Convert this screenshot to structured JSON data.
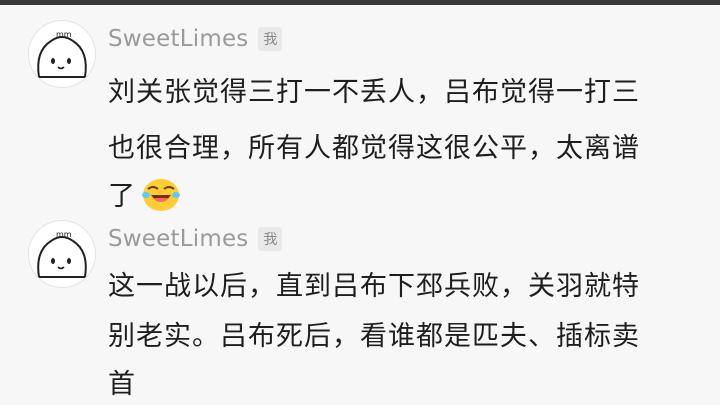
{
  "comments": [
    {
      "username": "SweetLimes",
      "badge": "我",
      "avatar_icon": "blob-character-icon",
      "lines": [
        "刘关张觉得三打一不丢人，吕布觉得一打三",
        "也很合理，所有人都觉得这很公平，太离谱",
        "了"
      ],
      "emoji": "laughing-crying-emoji"
    },
    {
      "username": "SweetLimes",
      "badge": "我",
      "avatar_icon": "blob-character-icon",
      "lines": [
        "这一战以后，直到吕布下邳兵败，关羽就特",
        "别老实。吕布死后，看谁都是匹夫、插标卖",
        "首"
      ]
    }
  ]
}
